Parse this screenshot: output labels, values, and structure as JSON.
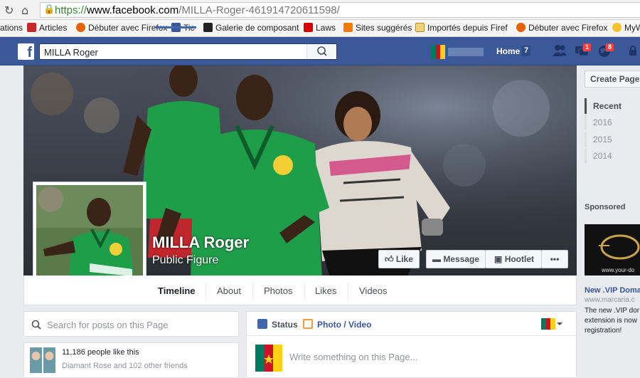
{
  "browser": {
    "url_scheme": "https://",
    "url_host": "www.facebook.com",
    "url_path": "/MILLA-Roger-461914720611598/"
  },
  "bookmarks": [
    {
      "label": "ations",
      "icon": "none"
    },
    {
      "label": "Articles",
      "icon": "tm-icon"
    },
    {
      "label": "Débuter avec Firefox",
      "icon": "firefox-icon"
    },
    {
      "label": "Tic",
      "icon": "facebook-icon"
    },
    {
      "label": "Galerie de composant",
      "icon": "galerie-icon"
    },
    {
      "label": "Laws",
      "icon": "laws-icon"
    },
    {
      "label": "Sites suggérés",
      "icon": "sites-icon"
    },
    {
      "label": "Importés depuis Firef",
      "icon": "folder-icon"
    },
    {
      "label": "Débuter avec Firefox",
      "icon": "firefox-icon"
    },
    {
      "label": "Débuter avec Firefox",
      "icon": "sun-icon"
    },
    {
      "label": "MyW",
      "icon": "myw-icon"
    }
  ],
  "topbar": {
    "logo": "f",
    "search_value": "MILLA Roger",
    "home_label": "Home",
    "home_count": "7",
    "messages_badge": "1",
    "notifications_badge": "8"
  },
  "page": {
    "name": "MILLA Roger",
    "category": "Public Figure",
    "buttons": {
      "like": "Like",
      "message": "Message",
      "hootlet": "Hootlet",
      "more": "•••"
    },
    "tabs": [
      "Timeline",
      "About",
      "Photos",
      "Likes",
      "Videos"
    ],
    "active_tab": "Timeline"
  },
  "left": {
    "search_placeholder": "Search for posts on this Page",
    "likes_count_text": "11,186 people like this",
    "likes_friends_text": "Diamant Rose and 102 other friends"
  },
  "composer": {
    "status_label": "Status",
    "photo_label": "Photo / Video",
    "placeholder": "Write something on this Page..."
  },
  "rightrail": {
    "create_page": "Create Page",
    "years": [
      "Recent",
      "2016",
      "2015",
      "2014"
    ],
    "sponsored": "Sponsored",
    "ad_image_text": "www.your-do",
    "ad_title": "New .VIP Domai",
    "ad_url": "www.marcaria.c",
    "ad_text": "The new .VIP dor extension is now registration!"
  },
  "colors": {
    "fb_blue": "#3b5998",
    "link": "#365899",
    "badge": "#fa3e3e",
    "jersey_green": "#1f9e4a"
  }
}
